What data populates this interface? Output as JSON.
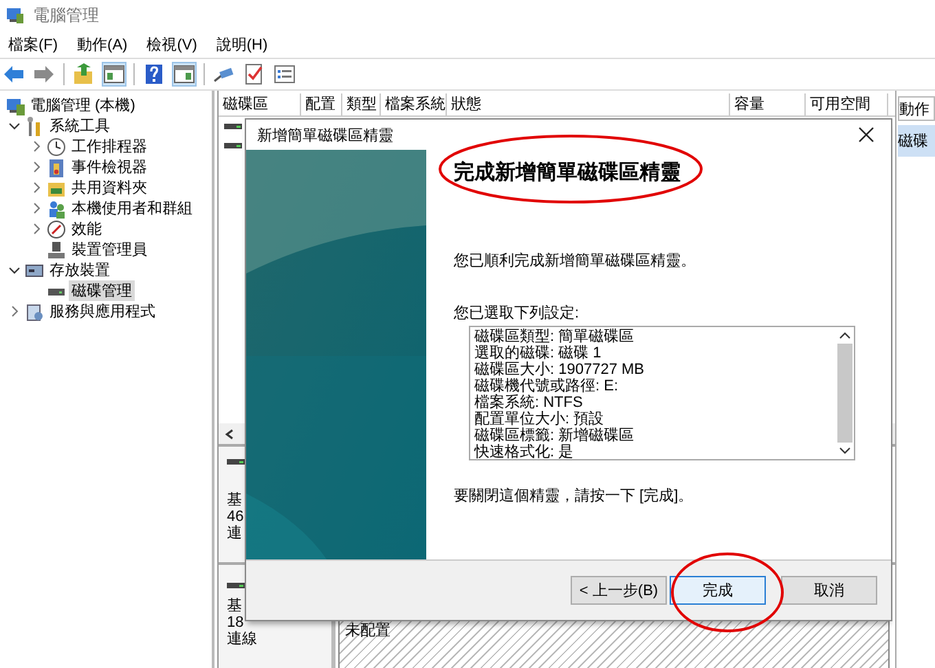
{
  "window": {
    "title": "電腦管理"
  },
  "menu": [
    {
      "label": "檔案(F)"
    },
    {
      "label": "動作(A)"
    },
    {
      "label": "檢視(V)"
    },
    {
      "label": "說明(H)"
    }
  ],
  "tree": [
    {
      "label": "電腦管理 (本機)",
      "selected": false,
      "children": [
        {
          "label": "系統工具",
          "expanded": true,
          "selected": false,
          "children": [
            {
              "label": "工作排程器",
              "expanded": false,
              "selected": false
            },
            {
              "label": "事件檢視器",
              "expanded": false,
              "selected": false
            },
            {
              "label": "共用資料夾",
              "expanded": false,
              "selected": false
            },
            {
              "label": "本機使用者和群組",
              "expanded": false,
              "selected": false
            },
            {
              "label": "效能",
              "expanded": false,
              "selected": false
            },
            {
              "label": "裝置管理員",
              "selected": false
            }
          ]
        },
        {
          "label": "存放裝置",
          "expanded": true,
          "selected": false,
          "children": [
            {
              "label": "磁碟管理",
              "selected": true
            }
          ]
        },
        {
          "label": "服務與應用程式",
          "expanded": false,
          "selected": false
        }
      ]
    }
  ],
  "volumes": {
    "columns": [
      "磁碟區",
      "配置",
      "類型",
      "檔案系統",
      "狀態",
      "容量",
      "可用空間"
    ]
  },
  "disks": [
    {
      "lines": [
        "基",
        "46",
        "連"
      ]
    },
    {
      "lines": [
        "基",
        "18",
        "連線"
      ],
      "partition": "未配置"
    }
  ],
  "action_pane": {
    "header": "動作",
    "items": [
      {
        "label": "磁碟",
        "selected": true
      }
    ]
  },
  "dialog": {
    "title": "新增簡單磁碟區精靈",
    "heading": "完成新增簡單磁碟區精靈",
    "intro": "您已順利完成新增簡單磁碟區精靈。",
    "settings_label": "您已選取下列設定:",
    "settings": [
      "磁碟區類型: 簡單磁碟區",
      "選取的磁碟: 磁碟 1",
      "磁碟區大小: 1907727 MB",
      "磁碟機代號或路徑: E:",
      "檔案系統: NTFS",
      "配置單位大小: 預設",
      "磁碟區標籤: 新增磁碟區",
      "快速格式化: 是"
    ],
    "closing": "要關閉這個精靈，請按一下 [完成]。",
    "buttons": [
      {
        "label": "< 上一步(B)",
        "default": false
      },
      {
        "label": "完成",
        "default": true
      },
      {
        "label": "取消",
        "default": false
      }
    ]
  }
}
